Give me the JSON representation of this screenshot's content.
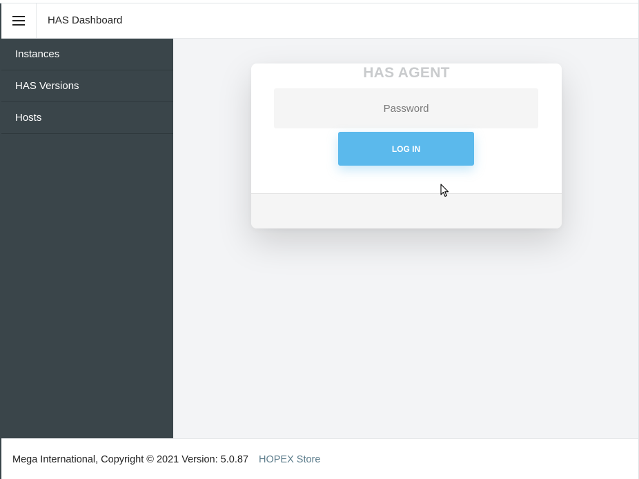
{
  "header": {
    "menu_icon": "hamburger-menu-icon",
    "title": "HAS Dashboard"
  },
  "sidebar": {
    "items": [
      {
        "label": "Instances"
      },
      {
        "label": "HAS Versions"
      },
      {
        "label": "Hosts"
      }
    ]
  },
  "login": {
    "title": "HAS AGENT",
    "password_placeholder": "Password",
    "password_value": "",
    "button_label": "LOG IN"
  },
  "footer": {
    "copyright": "Mega International, Copyright © 2021 Version: 5.0.87",
    "link_label": "HOPEX Store"
  },
  "colors": {
    "sidebar_bg": "#3a454a",
    "button_bg": "#5bb9ec",
    "main_bg": "#f3f4f6",
    "link": "#5d7d8c"
  }
}
